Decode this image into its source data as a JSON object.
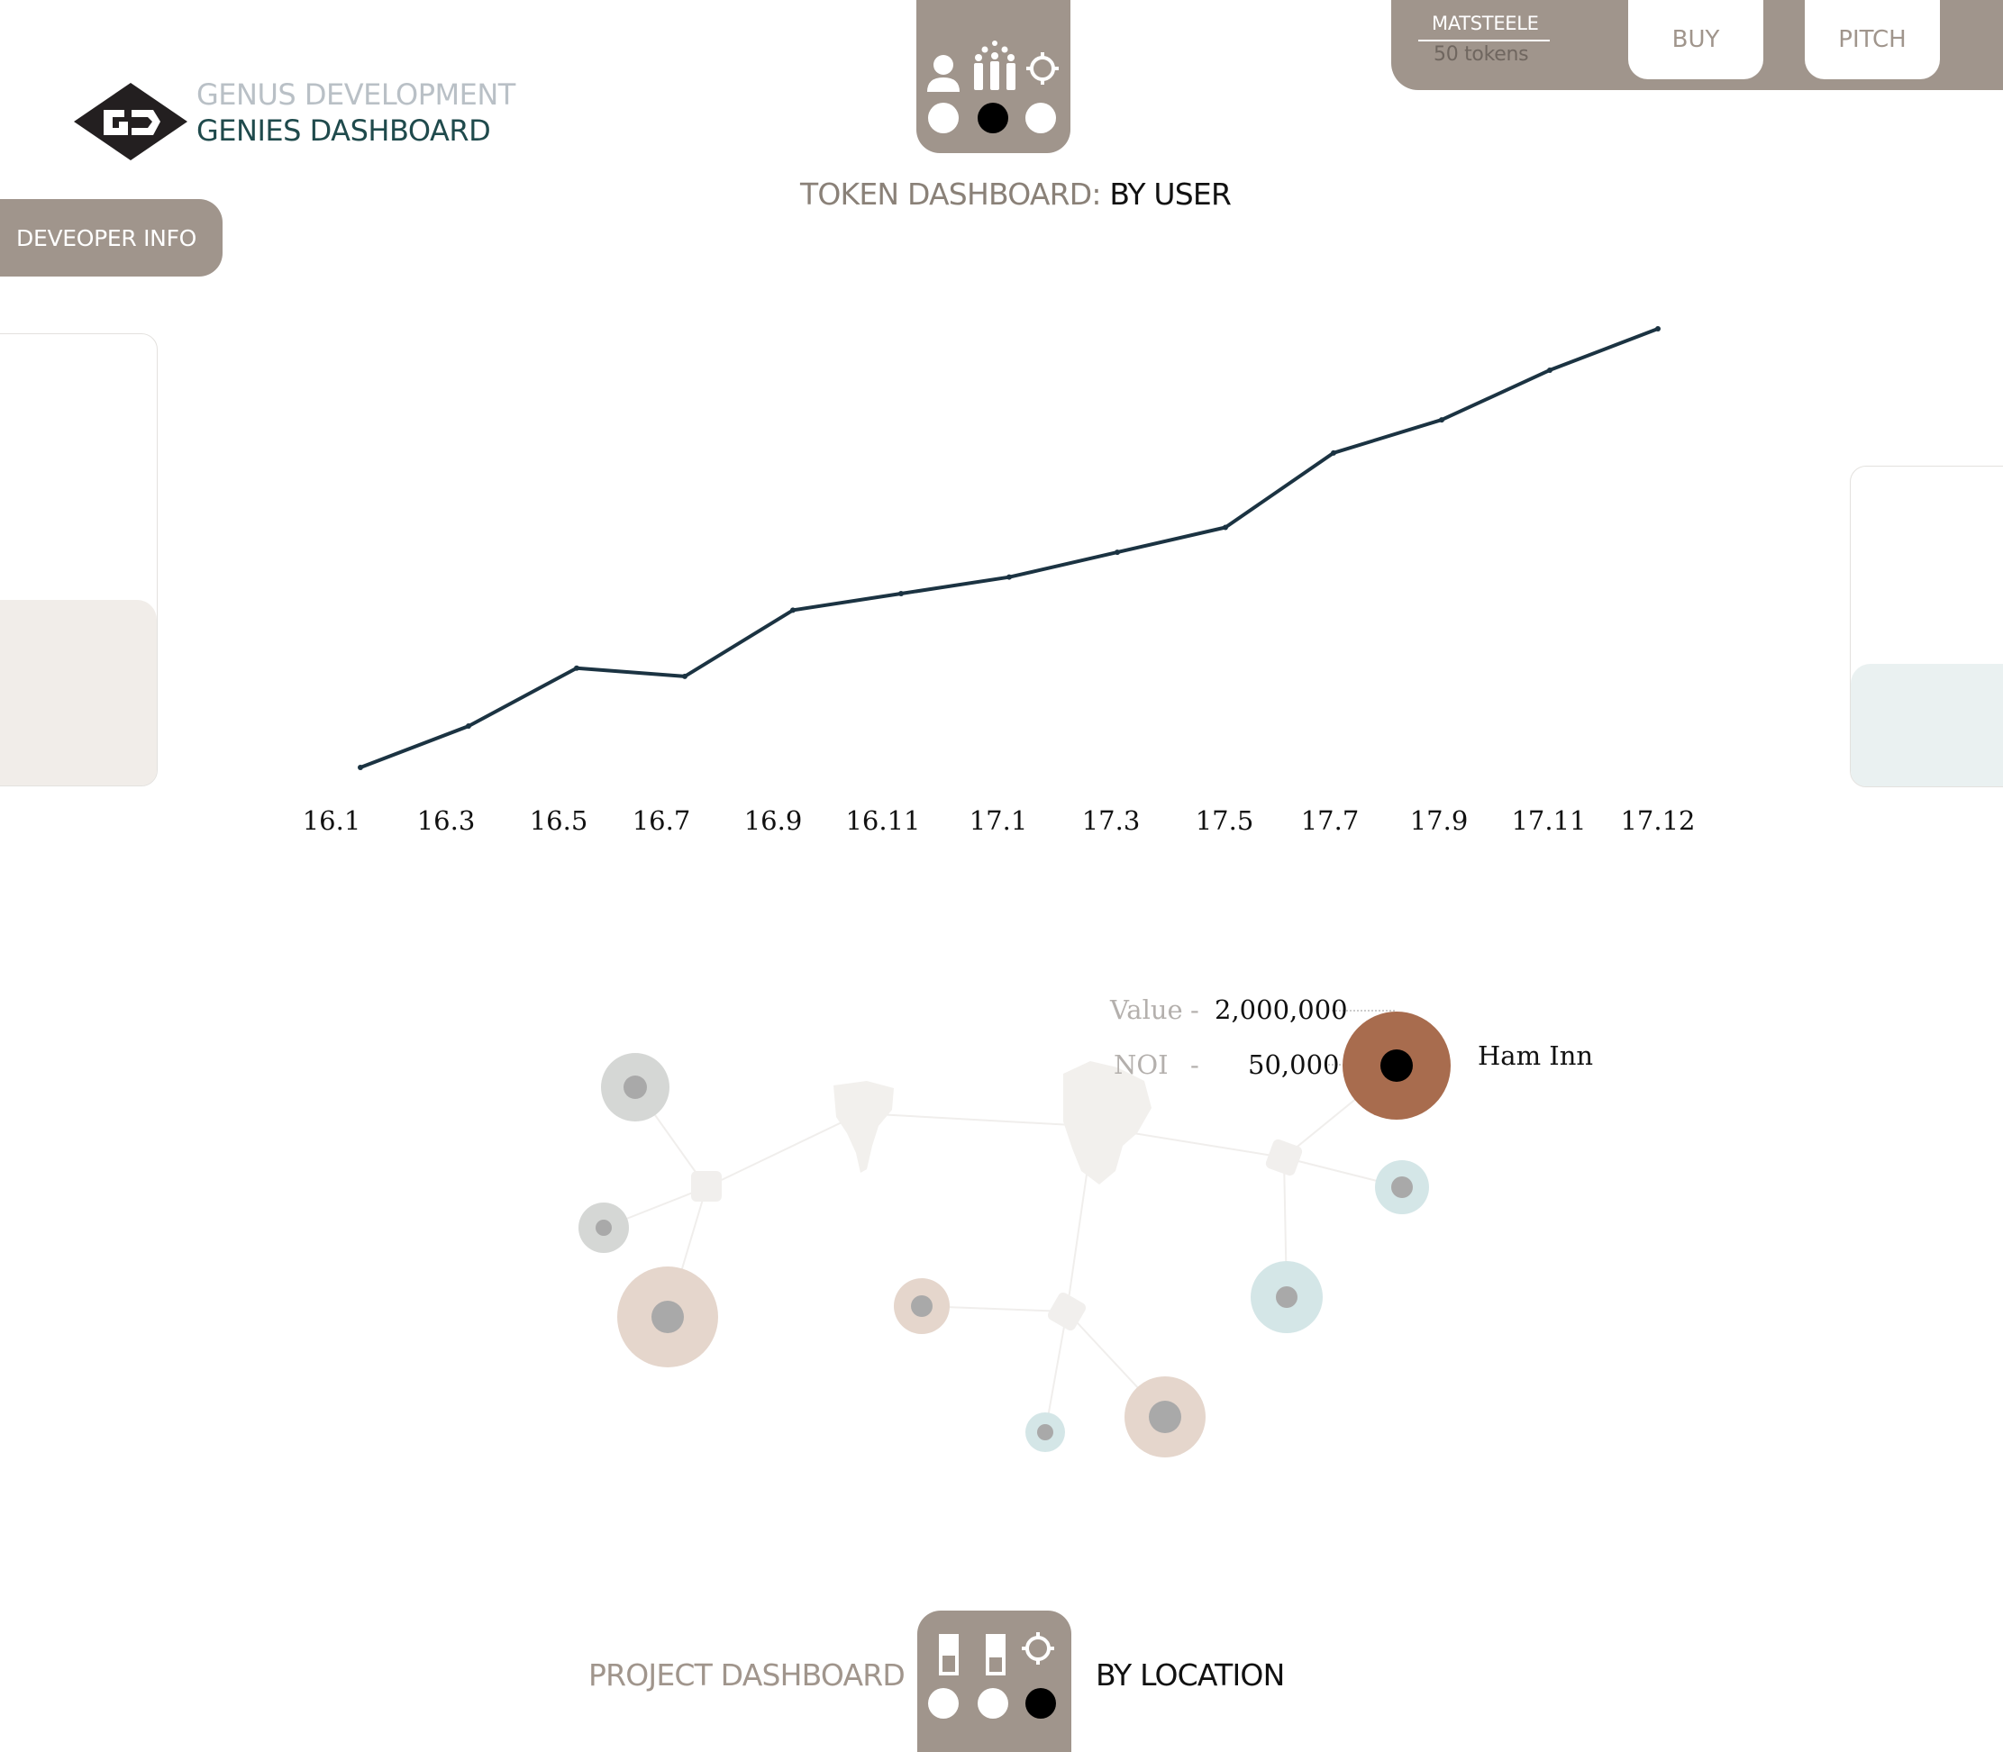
{
  "brand": {
    "line1": "GENUS DEVELOPMENT",
    "line2": "GENIES DASHBOARD"
  },
  "sidebar": {
    "developer_tab": "DEVEOPER INFO"
  },
  "account": {
    "username": "MATSTEELE",
    "tokens": "50 tokens",
    "buy_label": "BUY",
    "pitch_label": "PITCH"
  },
  "token_dashboard": {
    "title_prefix": "TOKEN DASHBOARD: ",
    "title_view": "BY USER",
    "view_switch": {
      "icons": [
        "user-icon",
        "group-icon",
        "crosshair-icon"
      ],
      "active_index": 1
    }
  },
  "chart_data": {
    "type": "line",
    "x": [
      "16.1",
      "16.3",
      "16.5",
      "16.7",
      "16.9",
      "16.11",
      "17.1",
      "17.3",
      "17.5",
      "17.7",
      "17.9",
      "17.11",
      "17.12"
    ],
    "tick_labels": [
      "16.1",
      "16.3",
      "16.5",
      "16.7",
      "16.9",
      "16.11",
      "17.1",
      "17.3",
      "17.5",
      "17.7",
      "17.9",
      "17.11",
      "17.12"
    ],
    "values": [
      0,
      5,
      12,
      11,
      19,
      21,
      23,
      26,
      29,
      38,
      42,
      48,
      53
    ],
    "line_color": "#1b3342",
    "grid": false,
    "title": "",
    "xlabel": "",
    "ylabel": ""
  },
  "project_map": {
    "tooltip": {
      "value_key": "Value",
      "value": "2,000,000",
      "noi_key": "NOI",
      "noi": "50,000",
      "project_name": "Ham Inn",
      "dash": "-"
    },
    "colors": {
      "highlight": "#a86c4e",
      "grey": "#d5d7d5",
      "tan": "#e5d6cc",
      "teal": "#d4e6e7",
      "core": "#a9a9a9",
      "hub": "#f1efed"
    }
  },
  "project_dashboard": {
    "title_left": "PROJECT DASHBOARD",
    "title_right": "BY LOCATION",
    "view_switch": {
      "icons": [
        "bar-low-icon",
        "bar-high-icon",
        "crosshair-icon"
      ],
      "active_index": 2
    }
  }
}
